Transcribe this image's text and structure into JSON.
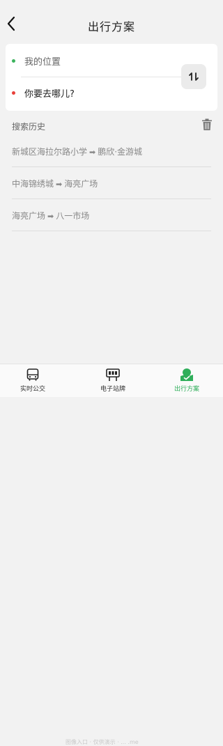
{
  "header": {
    "title": "出行方案"
  },
  "route": {
    "origin": "我的位置",
    "destination": "你要去哪儿?",
    "origin_dot_color": "#3cb35d",
    "destination_dot_color": "#e8403a"
  },
  "history": {
    "label": "搜索历史",
    "items": [
      {
        "from": "新城区海拉尔路小学",
        "to": "鹏欣·金游城"
      },
      {
        "from": "中海锦绣城",
        "to": "海亮广场"
      },
      {
        "from": "海亮广场",
        "to": "八一市场"
      }
    ]
  },
  "tabbar": {
    "tabs": [
      {
        "label": "实时公交",
        "icon": "bus-icon"
      },
      {
        "label": "电子站牌",
        "icon": "bus-stop-board-icon"
      },
      {
        "label": "出行方案",
        "icon": "route-plan-icon",
        "active": true
      }
    ],
    "watermark": "图像入口 · 仅供演示 · ... .me"
  },
  "colors": {
    "accent": "#2fae5a"
  }
}
